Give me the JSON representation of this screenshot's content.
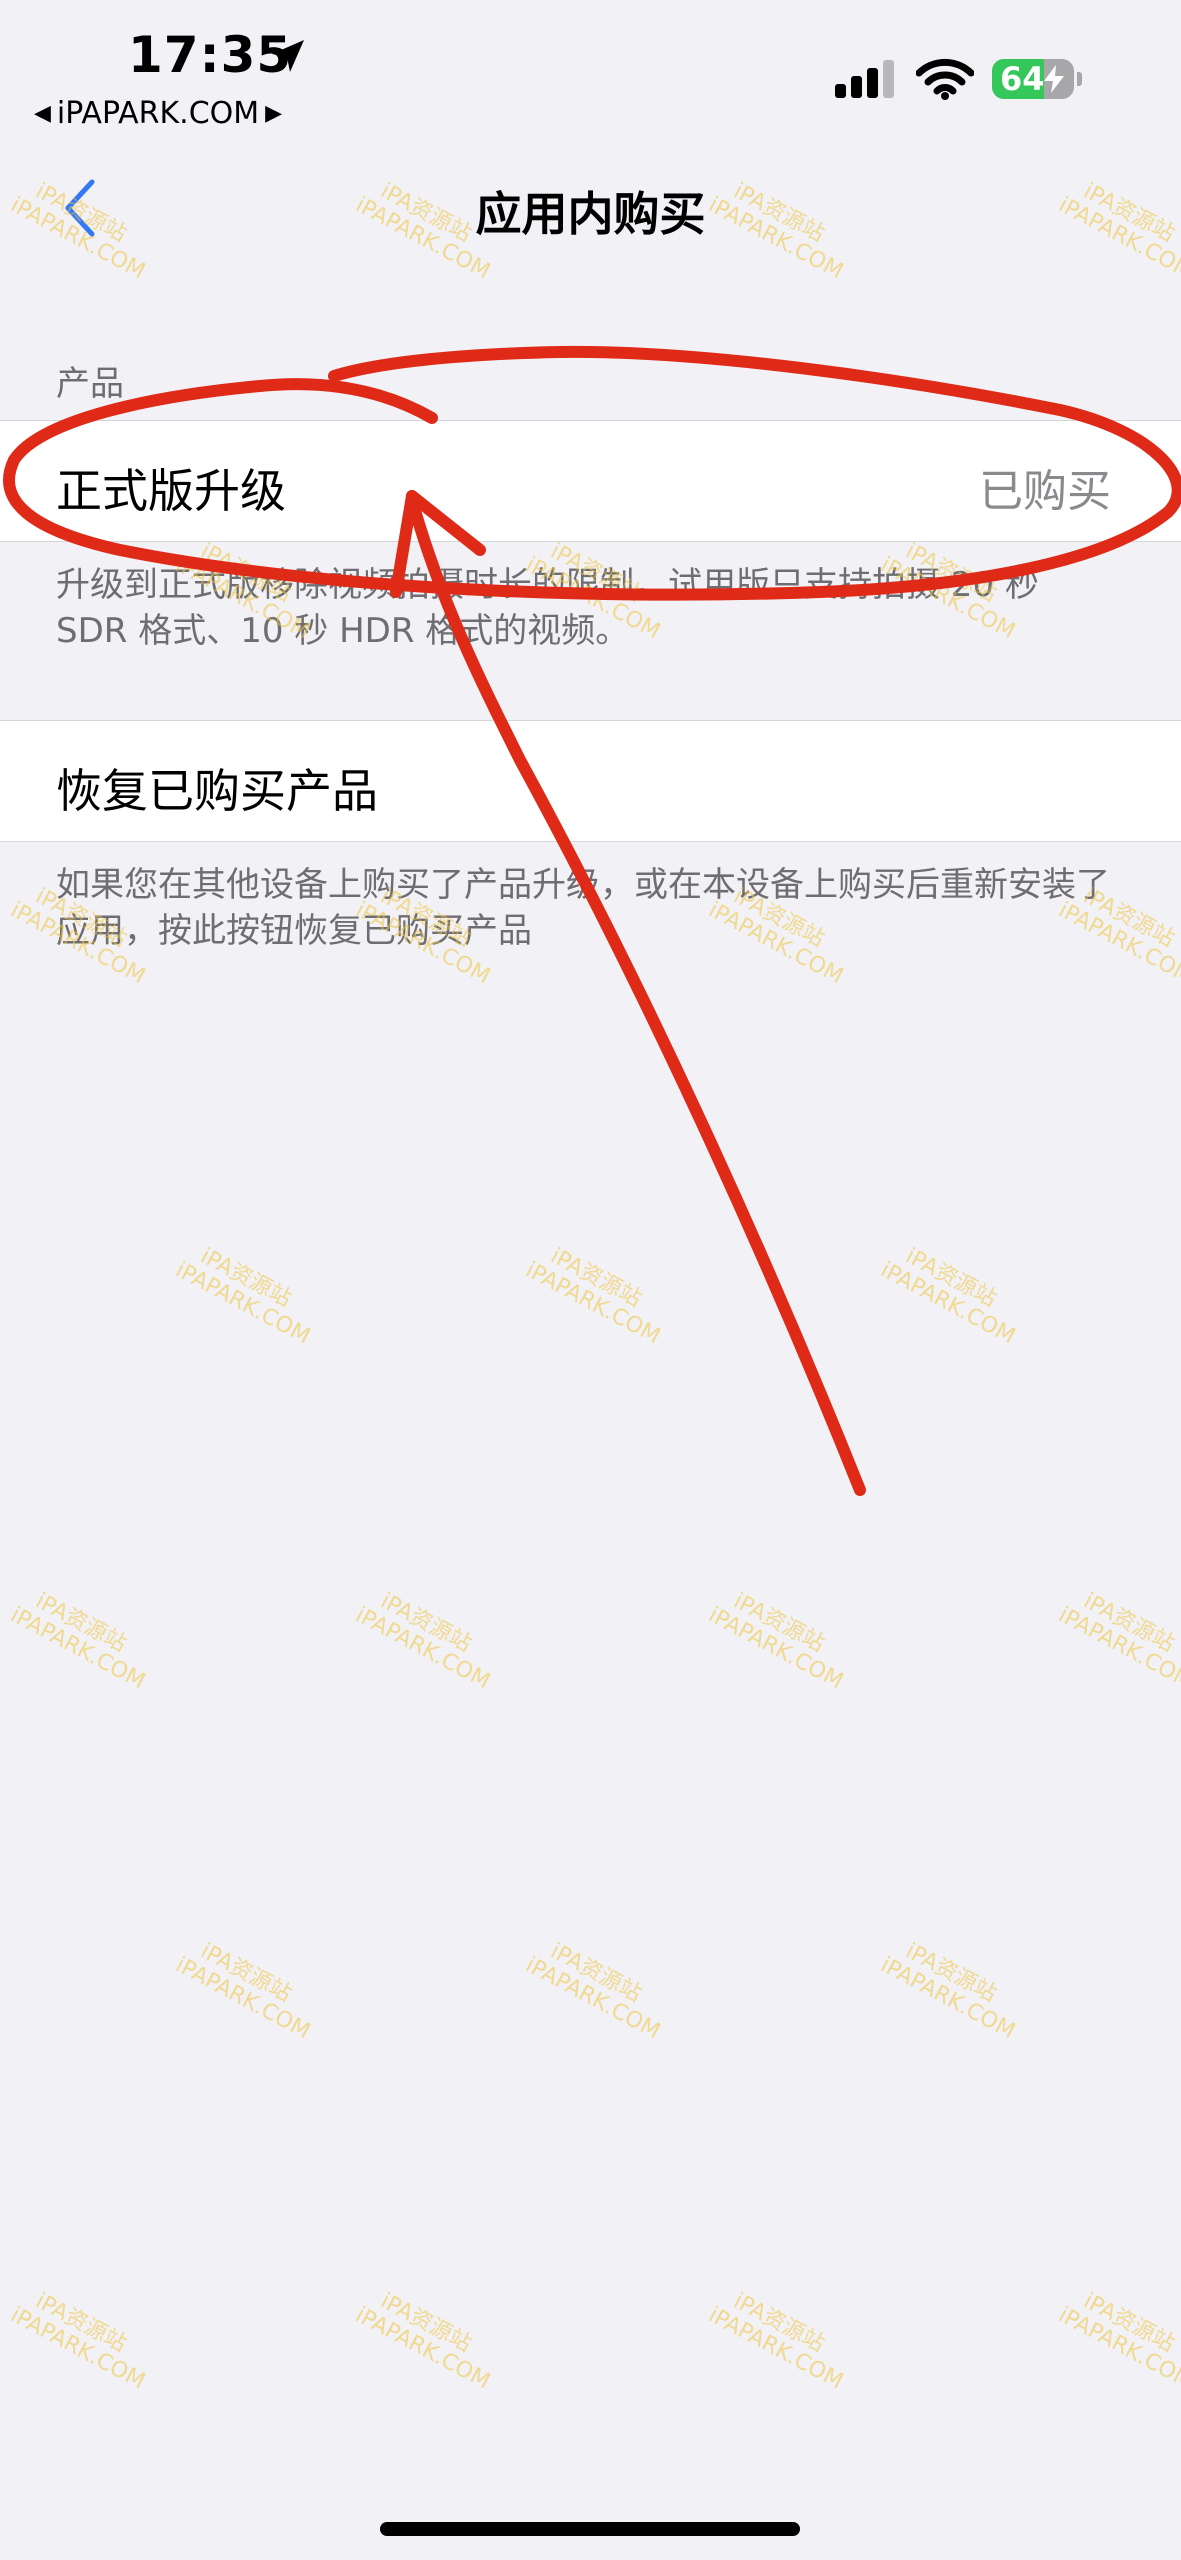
{
  "status_bar": {
    "time": "17:35",
    "back_app_label": "iPAPARK.COM",
    "back_arrow": "◀",
    "forward_arrow": "▶",
    "battery_level": "64",
    "battery_fraction": 0.64,
    "icons": [
      "location-arrow-icon",
      "cellular-signal-icon",
      "wifi-icon",
      "battery-icon",
      "charging-bolt-icon"
    ]
  },
  "nav": {
    "title": "应用内购买",
    "back_icon": "chevron-left-icon"
  },
  "section": {
    "header": "产品",
    "purchase_cell": {
      "label": "正式版升级",
      "value": "已购买"
    },
    "purchase_footer": "升级到正式版移除视频拍摄时长的限制，试用版只支持拍摄 20 秒 SDR 格式、10 秒 HDR 格式的视频。",
    "restore_cell": {
      "label": "恢复已购买产品"
    },
    "restore_footer": "如果您在其他设备上购买了产品升级，或在本设备上购买后重新安装了应用，按此按钮恢复已购买产品"
  },
  "watermark": {
    "line1": "iPA资源站",
    "line2": "iPAPARK.COM"
  },
  "colors": {
    "background": "#f2f1f6",
    "accent": "#3478f6",
    "battery_green": "#34c759",
    "annotation_red": "#e02a18",
    "watermark_yellow": "#eec43c"
  }
}
